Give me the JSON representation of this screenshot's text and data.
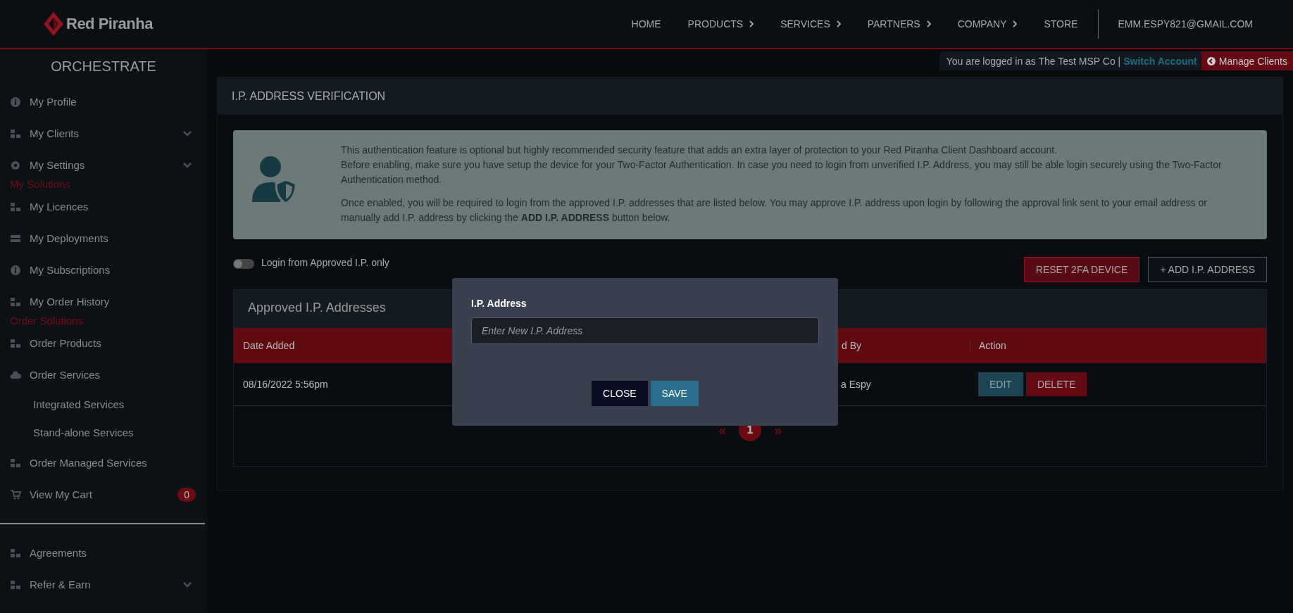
{
  "header": {
    "brand": "Red Piranha",
    "nav": [
      {
        "label": "HOME",
        "submenu": false
      },
      {
        "label": "PRODUCTS",
        "submenu": true
      },
      {
        "label": "SERVICES",
        "submenu": true
      },
      {
        "label": "PARTNERS",
        "submenu": true
      },
      {
        "label": "COMPANY",
        "submenu": true
      },
      {
        "label": "STORE",
        "submenu": false
      }
    ],
    "account": "EMM.ESPY821@GMAIL.COM"
  },
  "session_bar": {
    "text": "You are logged in as The Test MSP Co |",
    "switch_link": "Switch Account",
    "manage_button": "Manage Clients"
  },
  "sidebar": {
    "title": "ORCHESTRATE",
    "items": [
      {
        "kind": "link",
        "label": "My Profile",
        "expandable": false
      },
      {
        "kind": "link",
        "label": "My Clients",
        "expandable": true
      },
      {
        "kind": "link",
        "label": "My Settings",
        "expandable": true
      },
      {
        "kind": "heading",
        "label": "My Solutions"
      },
      {
        "kind": "link",
        "label": "My Licences",
        "expandable": false
      },
      {
        "kind": "link",
        "label": "My Deployments",
        "expandable": false
      },
      {
        "kind": "link",
        "label": "My Subscriptions",
        "expandable": false
      },
      {
        "kind": "link",
        "label": "My Order History",
        "expandable": false
      },
      {
        "kind": "heading",
        "label": "Order Solutions"
      },
      {
        "kind": "link",
        "label": "Order Products",
        "expandable": false
      },
      {
        "kind": "link",
        "label": "Order Services",
        "expandable": false
      },
      {
        "kind": "sublink",
        "label": "Integrated Services"
      },
      {
        "kind": "sublink",
        "label": "Stand-alone Services"
      },
      {
        "kind": "link",
        "label": "Order Managed Services",
        "expandable": false
      },
      {
        "kind": "link",
        "label": "View My Cart",
        "expandable": false,
        "badge": "0"
      },
      {
        "kind": "divider"
      },
      {
        "kind": "link",
        "label": "Agreements",
        "expandable": false
      },
      {
        "kind": "link",
        "label": "Refer & Earn",
        "expandable": true
      }
    ]
  },
  "panel": {
    "title": "I.P. ADDRESS VERIFICATION",
    "info": [
      "This authentication feature is optional but highly recommended security feature that adds an extra layer of protection to your Red Piranha Client Dashboard account.",
      "Before enabling, make sure you have setup the device for your Two-Factor Authentication. In case you need to login from unverified I.P. Address, you may still be able login securely using the Two-Factor Authentication method.",
      "Once enabled, you will be required to login from the approved I.P. addresses that are listed below. You may approve I.P. address upon login by following the approval link sent to your email address or manually add I.P. address by clicking the **ADD I.P. ADDRESS** button below."
    ],
    "toggle": {
      "label": "Login from Approved I.P. only",
      "on": false
    },
    "buttons": [
      {
        "kind": "danger",
        "label": "RESET 2FA DEVICE"
      },
      {
        "kind": "outline",
        "label": "+ ADD I.P. ADDRESS"
      }
    ],
    "table": {
      "title": "Approved I.P. Addresses",
      "columns": [
        "Date Added",
        "d By",
        "Action"
      ],
      "rows": [
        {
          "date_added": "08/16/2022 5:56pm",
          "column_3": "a Espy",
          "actions": [
            {
              "kind": "edit",
              "label": "EDIT"
            },
            {
              "kind": "delete",
              "label": "DELETE"
            }
          ]
        }
      ]
    },
    "pagination": {
      "prev": "«",
      "pages": [
        {
          "label": "1",
          "selected": true
        }
      ],
      "next": "»"
    }
  },
  "modal": {
    "field_label": "I.P. Address",
    "placeholder": "Enter New I.P. Address",
    "buttons": [
      {
        "kind": "close",
        "label": "CLOSE"
      },
      {
        "kind": "save",
        "label": "SAVE"
      }
    ]
  }
}
